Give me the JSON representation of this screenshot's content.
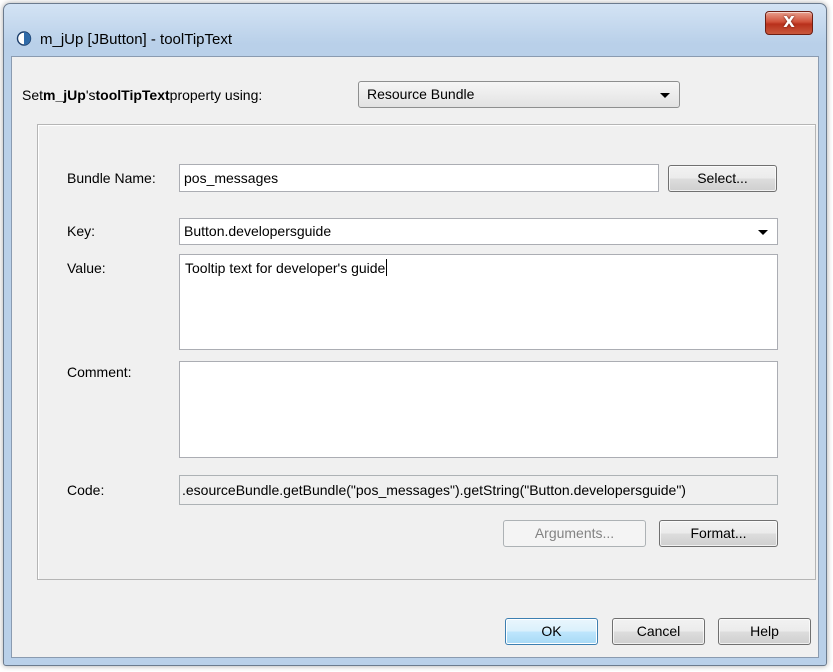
{
  "window": {
    "title": "m_jUp [JButton] - toolTipText",
    "close_glyph": "X",
    "accent_color": "#b9d0e9",
    "close_color": "#c9432a"
  },
  "header": {
    "prefix": "Set ",
    "component": "m_jUp",
    "possessive": "'s ",
    "property": "toolTipText",
    "suffix": " property using:",
    "mode_selected": "Resource Bundle"
  },
  "form": {
    "bundle_label": "Bundle Name:",
    "bundle_value": "pos_messages",
    "select_button": "Select...",
    "key_label": "Key:",
    "key_value": "Button.developersguide",
    "value_label": "Value:",
    "value_text": "Tooltip text for developer's guide",
    "comment_label": "Comment:",
    "comment_text": "",
    "code_label": "Code:",
    "code_value": ".esourceBundle.getBundle(\"pos_messages\").getString(\"Button.developersguide\")",
    "arguments_button": "Arguments...",
    "format_button": "Format..."
  },
  "footer": {
    "ok": "OK",
    "cancel": "Cancel",
    "help": "Help"
  }
}
